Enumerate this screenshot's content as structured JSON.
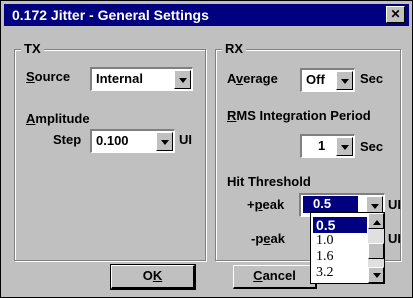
{
  "window": {
    "title": "0.172 Jitter - General Settings",
    "close_glyph": "✕"
  },
  "tx": {
    "group_label": "TX",
    "source_label_underlined": "S",
    "source_label_rest": "ource",
    "source_value": "Internal",
    "amplitude_label_underlined": "A",
    "amplitude_label_rest": "mplitude",
    "step_label": "Step",
    "step_value": "0.100",
    "step_unit": "UI"
  },
  "rx": {
    "group_label": "RX",
    "average_label_a": "A",
    "average_label_underlined": "v",
    "average_label_rest": "erage",
    "average_value": "Off",
    "average_unit": "Sec",
    "rms_label_underlined": "R",
    "rms_label_rest": "MS Integration Period",
    "rms_value": "1",
    "rms_unit": "Sec",
    "hit_threshold_label": "Hit Threshold",
    "ppeak_label_pre": "+",
    "ppeak_label_underlined": "p",
    "ppeak_label_rest": "eak",
    "ppeak_value": "0.5",
    "ppeak_unit": "UI",
    "npeak_label_pre": "-p",
    "npeak_label_underlined": "e",
    "npeak_label_rest": "ak",
    "npeak_unit": "UI"
  },
  "dropdown": {
    "options": [
      "0.5",
      "1.0",
      "1.6",
      "3.2"
    ],
    "selected_index": 0
  },
  "buttons": {
    "ok_pre": "O",
    "ok_underlined": "K",
    "cancel_underlined": "C",
    "cancel_rest": "ancel"
  },
  "colors": {
    "titlebar": "#000080",
    "face": "#c0c0c0",
    "selection": "#000080"
  }
}
